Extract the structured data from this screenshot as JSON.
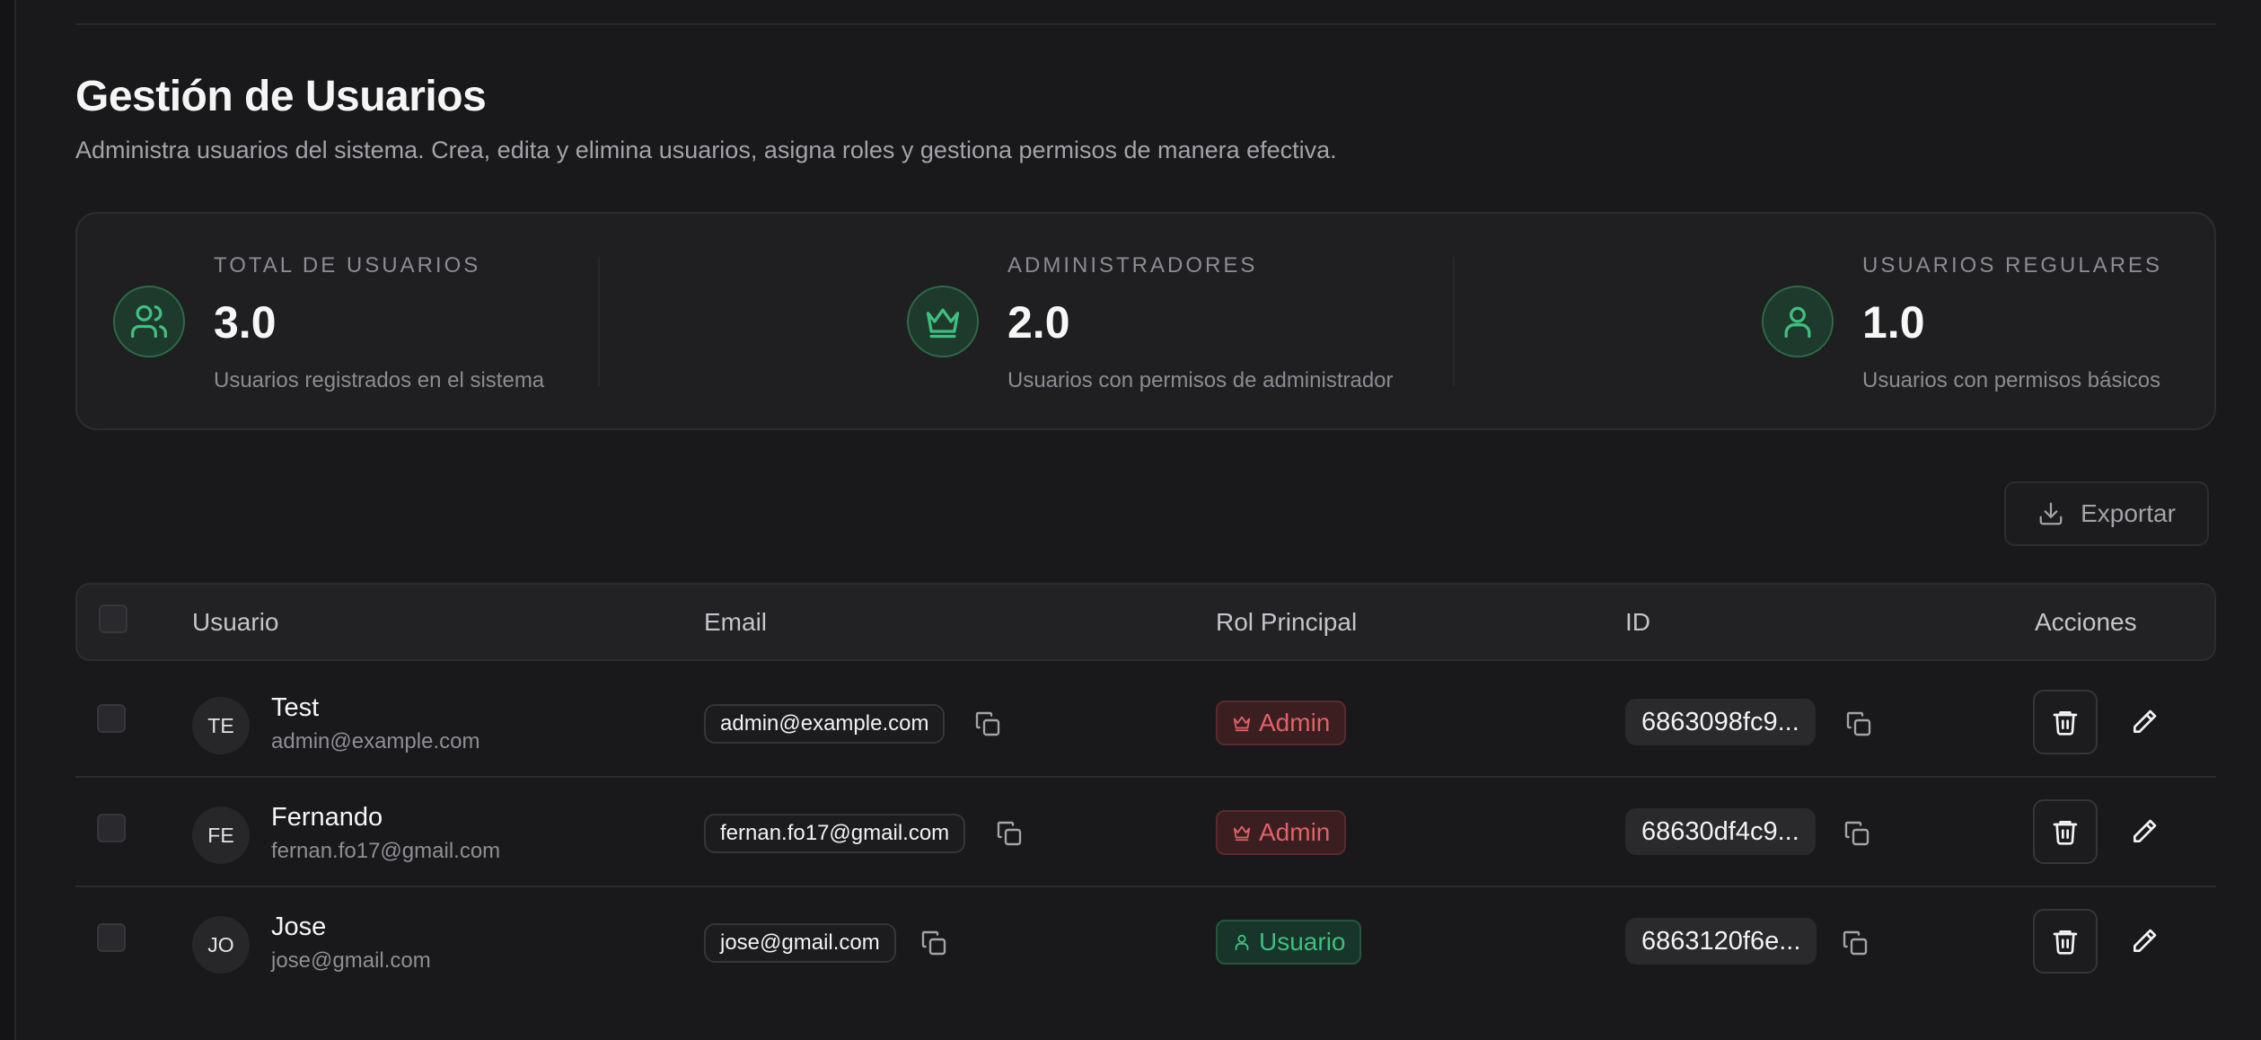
{
  "page": {
    "title": "Gestión de Usuarios",
    "subtitle": "Administra usuarios del sistema. Crea, edita y elimina usuarios, asigna roles y gestiona permisos de manera efectiva."
  },
  "stats": [
    {
      "label": "TOTAL DE USUARIOS",
      "value": "3.0",
      "description": "Usuarios registrados en el sistema",
      "icon": "users-icon"
    },
    {
      "label": "ADMINISTRADORES",
      "value": "2.0",
      "description": "Usuarios con permisos de administrador",
      "icon": "crown-icon"
    },
    {
      "label": "USUARIOS REGULARES",
      "value": "1.0",
      "description": "Usuarios con permisos básicos",
      "icon": "user-icon"
    }
  ],
  "toolbar": {
    "export_label": "Exportar"
  },
  "table": {
    "headers": {
      "user": "Usuario",
      "email": "Email",
      "role": "Rol Principal",
      "id": "ID",
      "actions": "Acciones"
    },
    "rows": [
      {
        "initials": "TE",
        "name": "Test",
        "email": "admin@example.com",
        "role": "Admin",
        "role_type": "admin",
        "id": "6863098fc9..."
      },
      {
        "initials": "FE",
        "name": "Fernando",
        "email": "fernan.fo17@gmail.com",
        "role": "Admin",
        "role_type": "admin",
        "id": "68630df4c9..."
      },
      {
        "initials": "JO",
        "name": "Jose",
        "email": "jose@gmail.com",
        "role": "Usuario",
        "role_type": "user",
        "id": "6863120f6e..."
      }
    ]
  },
  "colors": {
    "accent_green": "#3fbf7f",
    "admin_red": "#e06268",
    "background": "#19191b"
  }
}
